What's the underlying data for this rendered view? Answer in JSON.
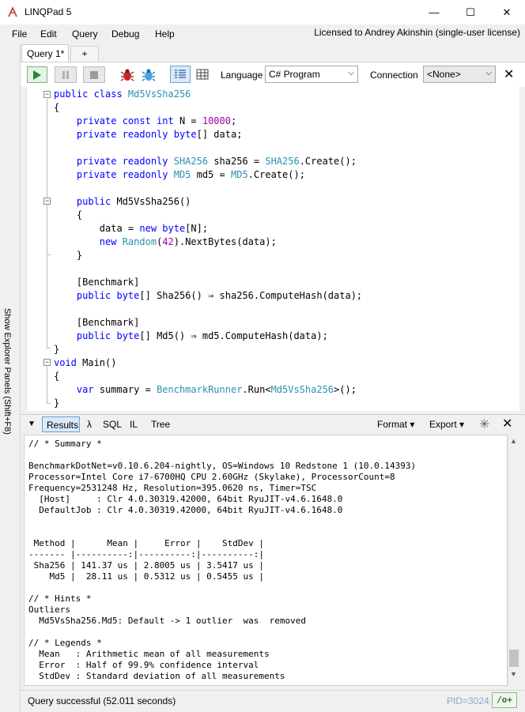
{
  "window": {
    "title": "LINQPad 5",
    "minimize_glyph": "—",
    "maximize_glyph": "☐",
    "close_glyph": "✕"
  },
  "menu": {
    "items": [
      {
        "label": "File"
      },
      {
        "label": "Edit"
      },
      {
        "label": "Query"
      },
      {
        "label": "Debug"
      },
      {
        "label": "Help"
      }
    ],
    "license": "Licensed to Andrey Akinshin (single-user license)"
  },
  "sidebar": {
    "label": "Show Explorer Panels  (Shift+F8)"
  },
  "tabs": {
    "query_tab": "Query 1*",
    "add_tab": "+"
  },
  "toolbar": {
    "language_label": "Language",
    "language_value": "C# Program",
    "connection_label": "Connection",
    "connection_value": "<None>",
    "close_glyph": "✕",
    "icons": [
      "run-icon",
      "pause-icon",
      "stop-icon",
      "bug-icon",
      "bug-icon",
      "text-results-icon",
      "grid-results-icon"
    ]
  },
  "editor": {
    "lines": [
      "public class Md5VsSha256",
      "{",
      "    private const int N = 10000;",
      "    private readonly byte[] data;",
      "",
      "    private readonly SHA256 sha256 = SHA256.Create();",
      "    private readonly MD5 md5 = MD5.Create();",
      "",
      "    public Md5VsSha256()",
      "    {",
      "        data = new byte[N];",
      "        new Random(42).NextBytes(data);",
      "    }",
      "",
      "    [Benchmark]",
      "    public byte[] Sha256() ⇒ sha256.ComputeHash(data);",
      "",
      "    [Benchmark]",
      "    public byte[] Md5() ⇒ md5.ComputeHash(data);",
      "}",
      "void Main()",
      "{",
      "    var summary = BenchmarkRunner.Run<Md5VsSha256>();",
      "}"
    ],
    "colors": {
      "keyword": "#0000ff",
      "type": "#2b91af",
      "number": "#a000a0"
    }
  },
  "results_bar": {
    "collapse_glyph": "▼",
    "tabs": [
      {
        "label": "Results"
      },
      {
        "label": "λ"
      },
      {
        "label": "SQL"
      },
      {
        "label": "IL"
      },
      {
        "label": "Tree"
      }
    ],
    "format_label": "Format ▾",
    "export_label": "Export ▾",
    "close_glyph": "✕"
  },
  "output": {
    "lines": [
      "// * Summary *",
      "",
      "BenchmarkDotNet=v0.10.6.204-nightly, OS=Windows 10 Redstone 1 (10.0.14393)",
      "Processor=Intel Core i7-6700HQ CPU 2.60GHz (Skylake), ProcessorCount=8",
      "Frequency=2531248 Hz, Resolution=395.0620 ns, Timer=TSC",
      "  [Host]     : Clr 4.0.30319.42000, 64bit RyuJIT-v4.6.1648.0",
      "  DefaultJob : Clr 4.0.30319.42000, 64bit RyuJIT-v4.6.1648.0",
      "",
      "",
      " Method |      Mean |     Error |    StdDev |",
      "------- |----------:|----------:|----------:|",
      " Sha256 | 141.37 us | 2.8005 us | 3.5417 us |",
      "    Md5 |  28.11 us | 0.5312 us | 0.5455 us |",
      "",
      "// * Hints *",
      "Outliers",
      "  Md5VsSha256.Md5: Default -> 1 outlier  was  removed",
      "",
      "// * Legends *",
      "  Mean   : Arithmetic mean of all measurements",
      "  Error  : Half of 99.9% confidence interval",
      "  StdDev : Standard deviation of all measurements"
    ]
  },
  "status": {
    "text": "Query successful  (52.011 seconds)",
    "pid": "PID=3024",
    "optimize": "/o+"
  }
}
